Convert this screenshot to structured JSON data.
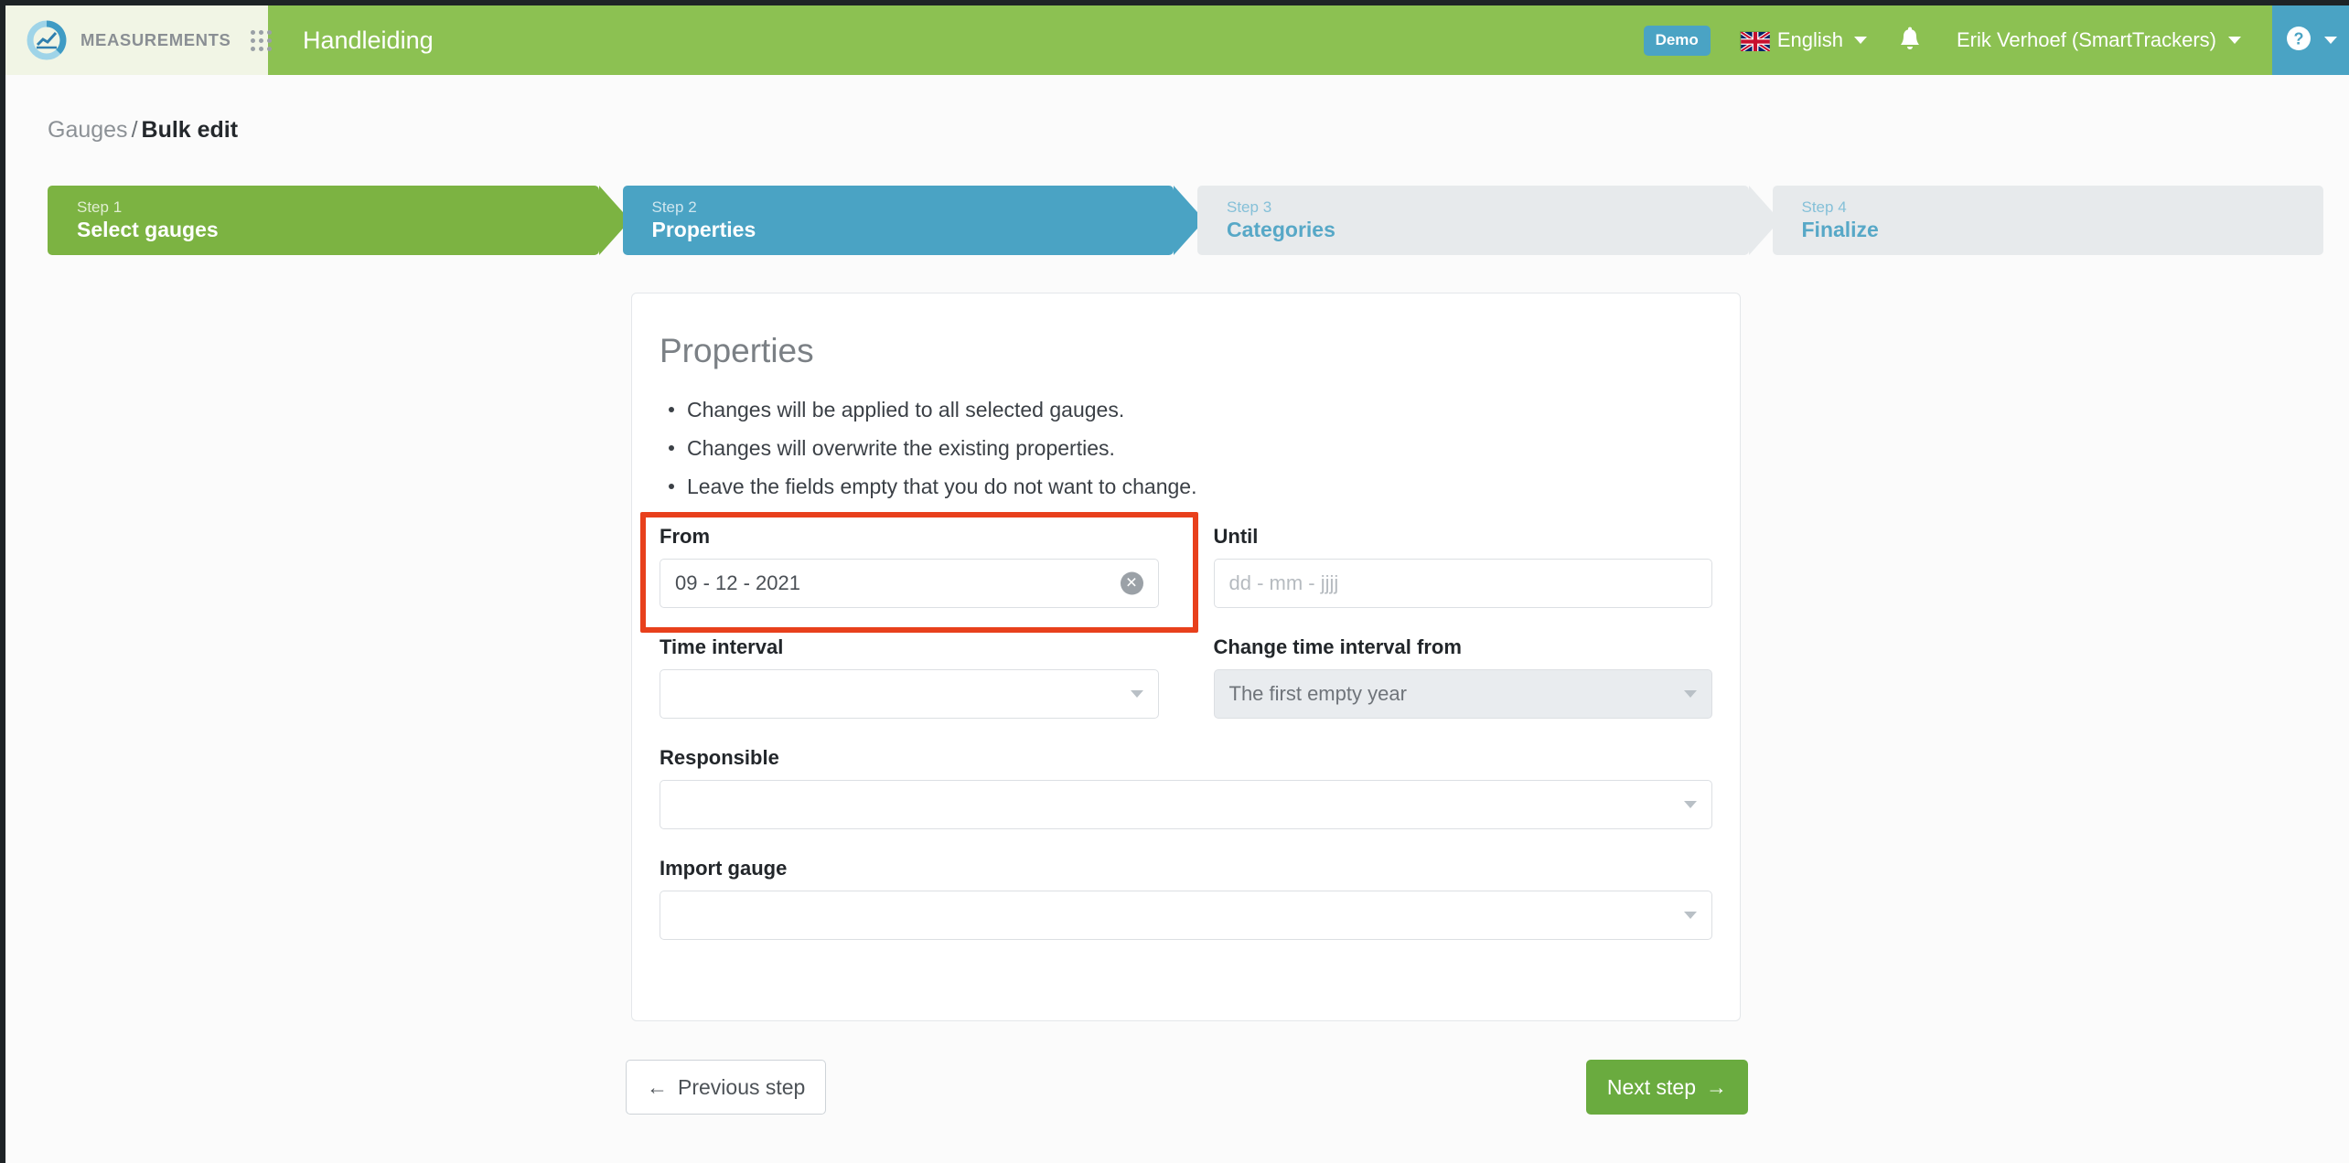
{
  "theme": {
    "brand_green": "#8cc152",
    "step_done_green": "#7cb342",
    "step_active_blue": "#4aa3c4",
    "step_todo_grey": "#e7eaec",
    "highlight_red": "#e8401c",
    "next_button_green": "#6aab3f"
  },
  "header": {
    "brand_name": "MEASUREMENTS",
    "app_title": "Handleiding",
    "demo_badge": "Demo",
    "language": "English",
    "user": "Erik Verhoef (SmartTrackers)"
  },
  "breadcrumb": {
    "parent": "Gauges",
    "separator": "/",
    "current": "Bulk edit"
  },
  "steps": [
    {
      "number": "Step 1",
      "label": "Select gauges",
      "state": "done"
    },
    {
      "number": "Step 2",
      "label": "Properties",
      "state": "active"
    },
    {
      "number": "Step 3",
      "label": "Categories",
      "state": "todo"
    },
    {
      "number": "Step 4",
      "label": "Finalize",
      "state": "todo"
    }
  ],
  "card": {
    "title": "Properties",
    "bullets": [
      "Changes will be applied to all selected gauges.",
      "Changes will overwrite the existing properties.",
      "Leave the fields empty that you do not want to change."
    ],
    "fields": {
      "from": {
        "label": "From",
        "value": "09 - 12 - 2021",
        "placeholder": "dd - mm - jjjj"
      },
      "until": {
        "label": "Until",
        "value": "",
        "placeholder": "dd - mm - jjjj"
      },
      "time_interval": {
        "label": "Time interval",
        "value": "",
        "placeholder": ""
      },
      "change_time_interval_from": {
        "label": "Change time interval from",
        "value": "The first empty year",
        "placeholder": ""
      },
      "responsible": {
        "label": "Responsible",
        "value": "",
        "placeholder": ""
      },
      "import_gauge": {
        "label": "Import gauge",
        "value": "",
        "placeholder": ""
      }
    }
  },
  "footer": {
    "previous_label": "Previous step",
    "previous_arrow": "←",
    "next_label": "Next step",
    "next_arrow": "→"
  }
}
